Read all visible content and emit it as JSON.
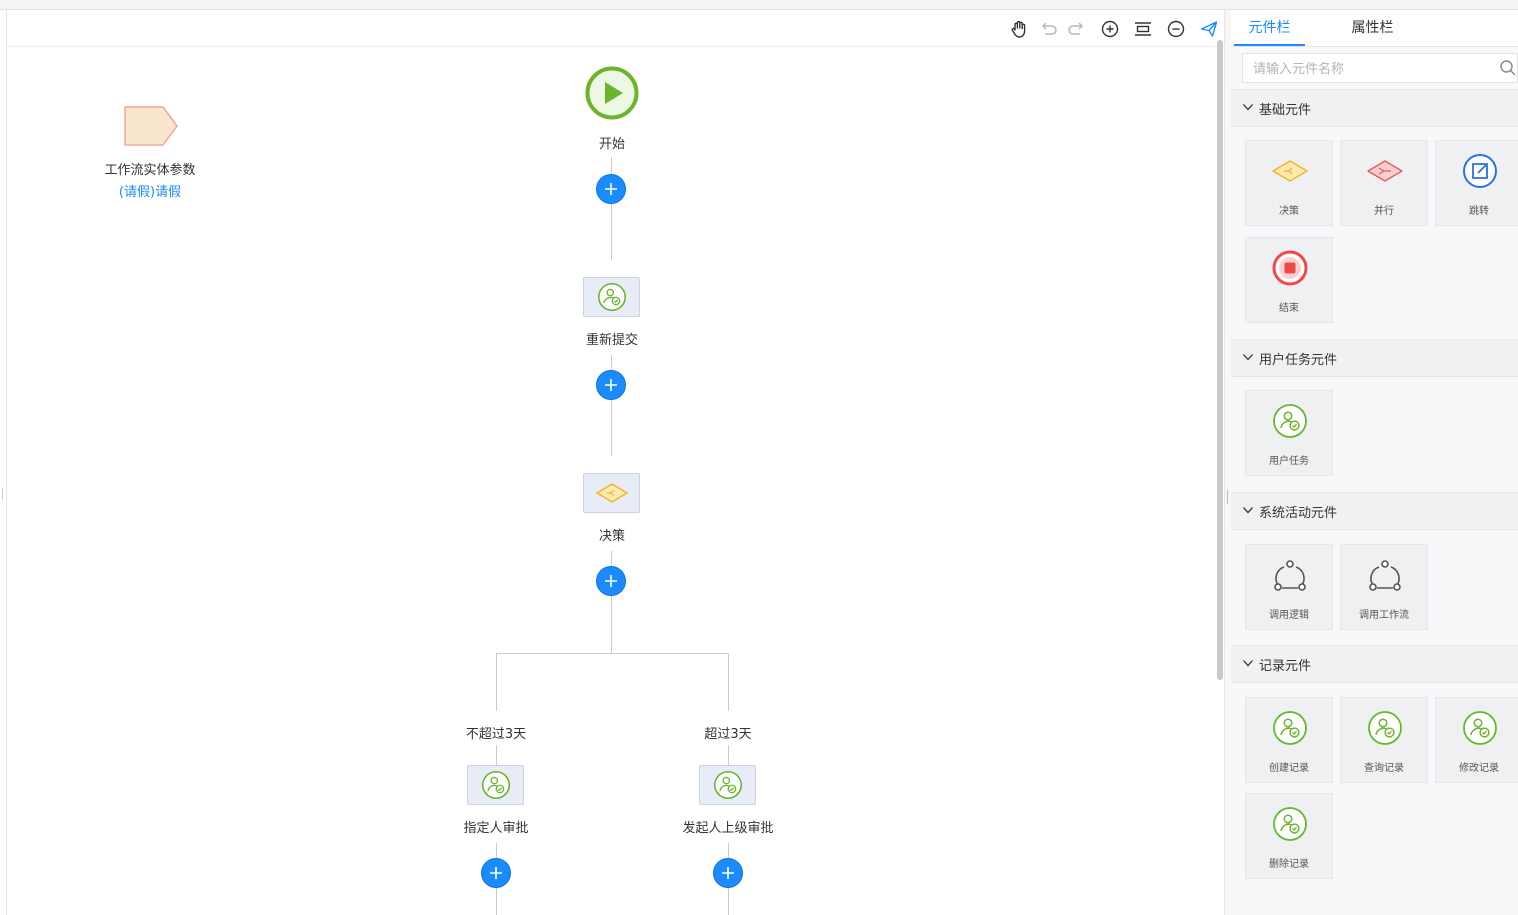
{
  "toolbar": {
    "icons": [
      "hand-icon",
      "undo-icon",
      "redo-icon",
      "zoom-in-icon",
      "fit-icon",
      "zoom-out-icon",
      "send-icon"
    ]
  },
  "entity": {
    "label": "工作流实体参数",
    "link": "(请假)请假"
  },
  "flow": {
    "start_label": "开始",
    "resubmit_label": "重新提交",
    "decision_label": "决策",
    "branch_left_condition": "不超过3天",
    "branch_right_condition": "超过3天",
    "left_task_label": "指定人审批",
    "right_task_label": "发起人上级审批"
  },
  "panel": {
    "tabs": [
      "元件栏",
      "属性栏"
    ],
    "active_tab": "元件栏",
    "search_placeholder": "请输入元件名称",
    "sections": [
      {
        "title": "基础元件",
        "items": [
          "决策",
          "并行",
          "跳转",
          "结束"
        ]
      },
      {
        "title": "用户任务元件",
        "items": [
          "用户任务"
        ]
      },
      {
        "title": "系统活动元件",
        "items": [
          "调用逻辑",
          "调用工作流"
        ]
      },
      {
        "title": "记录元件",
        "items": [
          "创建记录",
          "查询记录",
          "修改记录",
          "删除记录"
        ]
      }
    ]
  },
  "colors": {
    "accent": "#1a8cff",
    "green": "#6bb52c",
    "decision": "#f5b41e",
    "parallel": "#e85a5a",
    "end": "#f04848"
  }
}
